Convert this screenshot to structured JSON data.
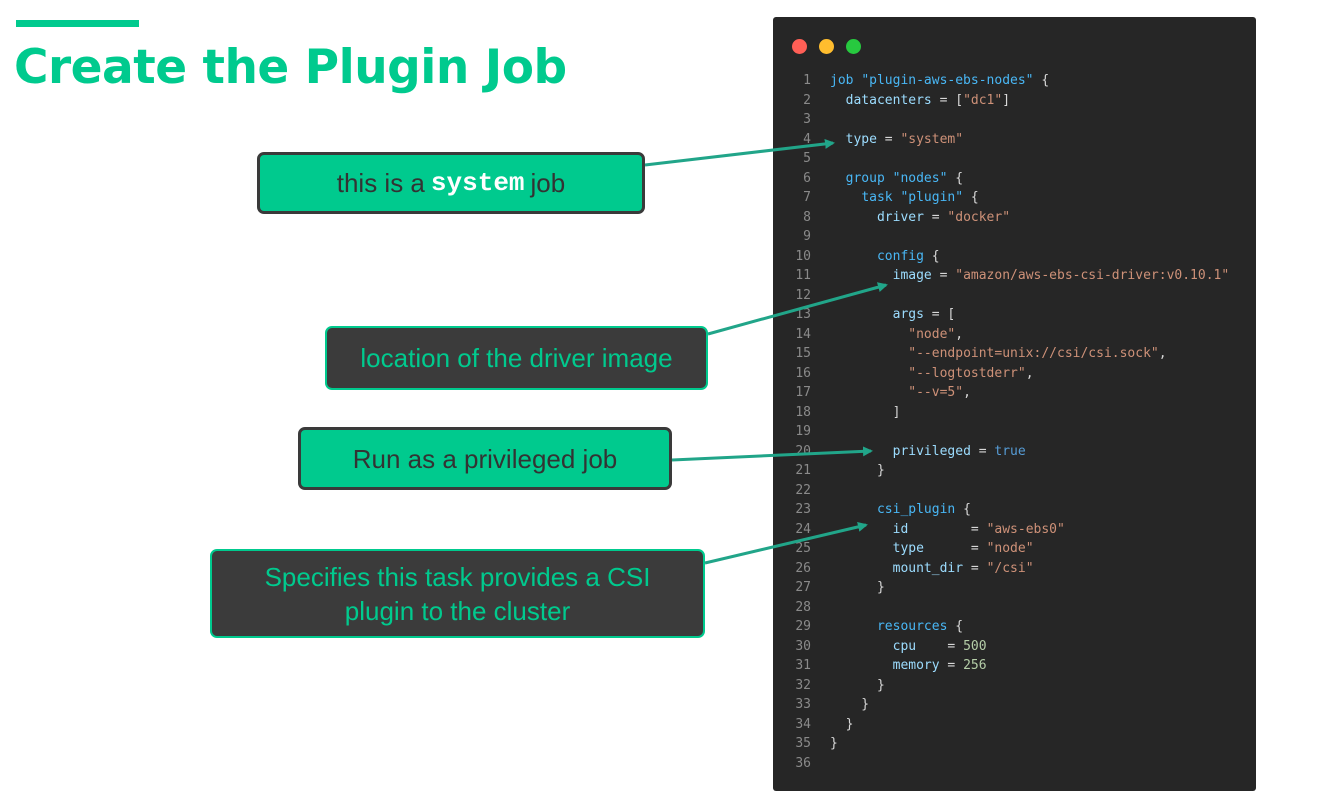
{
  "slide": {
    "title": "Create the Plugin Job"
  },
  "callouts": [
    {
      "pre": "this is a",
      "code": "system",
      "post": "job"
    },
    {
      "text": "location of the driver image"
    },
    {
      "text": "Run as a privileged job"
    },
    {
      "text": "Specifies this task provides a CSI plugin to the cluster"
    }
  ],
  "editor": {
    "lines": [
      {
        "n": "1",
        "tokens": [
          {
            "t": "job",
            "c": "#49b7f5"
          },
          {
            "t": " "
          },
          {
            "t": "\"plugin-aws-ebs-nodes\"",
            "c": "#49b7f5"
          },
          {
            "t": " {"
          }
        ]
      },
      {
        "n": "2",
        "tokens": [
          {
            "t": "  "
          },
          {
            "t": "datacenters",
            "c": "#9cdcfe"
          },
          {
            "t": " = ["
          },
          {
            "t": "\"dc1\"",
            "c": "#ce9178"
          },
          {
            "t": "]"
          }
        ]
      },
      {
        "n": "3",
        "tokens": []
      },
      {
        "n": "4",
        "tokens": [
          {
            "t": "  "
          },
          {
            "t": "type",
            "c": "#9cdcfe"
          },
          {
            "t": " = "
          },
          {
            "t": "\"system\"",
            "c": "#ce9178"
          }
        ]
      },
      {
        "n": "5",
        "tokens": []
      },
      {
        "n": "6",
        "tokens": [
          {
            "t": "  "
          },
          {
            "t": "group",
            "c": "#49b7f5"
          },
          {
            "t": " "
          },
          {
            "t": "\"nodes\"",
            "c": "#49b7f5"
          },
          {
            "t": " {"
          }
        ]
      },
      {
        "n": "7",
        "tokens": [
          {
            "t": "    "
          },
          {
            "t": "task",
            "c": "#49b7f5"
          },
          {
            "t": " "
          },
          {
            "t": "\"plugin\"",
            "c": "#49b7f5"
          },
          {
            "t": " {"
          }
        ]
      },
      {
        "n": "8",
        "tokens": [
          {
            "t": "      "
          },
          {
            "t": "driver",
            "c": "#9cdcfe"
          },
          {
            "t": " = "
          },
          {
            "t": "\"docker\"",
            "c": "#ce9178"
          }
        ]
      },
      {
        "n": "9",
        "tokens": []
      },
      {
        "n": "10",
        "tokens": [
          {
            "t": "      "
          },
          {
            "t": "config",
            "c": "#49b7f5"
          },
          {
            "t": " {"
          }
        ]
      },
      {
        "n": "11",
        "tokens": [
          {
            "t": "        "
          },
          {
            "t": "image",
            "c": "#9cdcfe"
          },
          {
            "t": " = "
          },
          {
            "t": "\"amazon/aws-ebs-csi-driver:v0.10.1\"",
            "c": "#ce9178"
          }
        ]
      },
      {
        "n": "12",
        "tokens": []
      },
      {
        "n": "13",
        "tokens": [
          {
            "t": "        "
          },
          {
            "t": "args",
            "c": "#9cdcfe"
          },
          {
            "t": " = ["
          }
        ]
      },
      {
        "n": "14",
        "tokens": [
          {
            "t": "          "
          },
          {
            "t": "\"node\"",
            "c": "#ce9178"
          },
          {
            "t": ","
          }
        ]
      },
      {
        "n": "15",
        "tokens": [
          {
            "t": "          "
          },
          {
            "t": "\"--endpoint=unix://csi/csi.sock\"",
            "c": "#ce9178"
          },
          {
            "t": ","
          }
        ]
      },
      {
        "n": "16",
        "tokens": [
          {
            "t": "          "
          },
          {
            "t": "\"--logtostderr\"",
            "c": "#ce9178"
          },
          {
            "t": ","
          }
        ]
      },
      {
        "n": "17",
        "tokens": [
          {
            "t": "          "
          },
          {
            "t": "\"--v=5\"",
            "c": "#ce9178"
          },
          {
            "t": ","
          }
        ]
      },
      {
        "n": "18",
        "tokens": [
          {
            "t": "        ]"
          }
        ]
      },
      {
        "n": "19",
        "tokens": []
      },
      {
        "n": "20",
        "tokens": [
          {
            "t": "        "
          },
          {
            "t": "privileged",
            "c": "#9cdcfe"
          },
          {
            "t": " = "
          },
          {
            "t": "true",
            "c": "#569cd6"
          }
        ]
      },
      {
        "n": "21",
        "tokens": [
          {
            "t": "      }"
          }
        ]
      },
      {
        "n": "22",
        "tokens": []
      },
      {
        "n": "23",
        "tokens": [
          {
            "t": "      "
          },
          {
            "t": "csi_plugin",
            "c": "#49b7f5"
          },
          {
            "t": " {"
          }
        ]
      },
      {
        "n": "24",
        "tokens": [
          {
            "t": "        "
          },
          {
            "t": "id",
            "c": "#9cdcfe"
          },
          {
            "t": "        = "
          },
          {
            "t": "\"aws-ebs0\"",
            "c": "#ce9178"
          }
        ]
      },
      {
        "n": "25",
        "tokens": [
          {
            "t": "        "
          },
          {
            "t": "type",
            "c": "#9cdcfe"
          },
          {
            "t": "      = "
          },
          {
            "t": "\"node\"",
            "c": "#ce9178"
          }
        ]
      },
      {
        "n": "26",
        "tokens": [
          {
            "t": "        "
          },
          {
            "t": "mount_dir",
            "c": "#9cdcfe"
          },
          {
            "t": " = "
          },
          {
            "t": "\"/csi\"",
            "c": "#ce9178"
          }
        ]
      },
      {
        "n": "27",
        "tokens": [
          {
            "t": "      }"
          }
        ]
      },
      {
        "n": "28",
        "tokens": []
      },
      {
        "n": "29",
        "tokens": [
          {
            "t": "      "
          },
          {
            "t": "resources",
            "c": "#49b7f5"
          },
          {
            "t": " {"
          }
        ]
      },
      {
        "n": "30",
        "tokens": [
          {
            "t": "        "
          },
          {
            "t": "cpu",
            "c": "#9cdcfe"
          },
          {
            "t": "    = "
          },
          {
            "t": "500",
            "c": "#b5cea8"
          }
        ]
      },
      {
        "n": "31",
        "tokens": [
          {
            "t": "        "
          },
          {
            "t": "memory",
            "c": "#9cdcfe"
          },
          {
            "t": " = "
          },
          {
            "t": "256",
            "c": "#b5cea8"
          }
        ]
      },
      {
        "n": "32",
        "tokens": [
          {
            "t": "      }"
          }
        ]
      },
      {
        "n": "33",
        "tokens": [
          {
            "t": "    }"
          }
        ]
      },
      {
        "n": "34",
        "tokens": [
          {
            "t": "  }"
          }
        ]
      },
      {
        "n": "35",
        "tokens": [
          {
            "t": "}"
          }
        ]
      },
      {
        "n": "36",
        "tokens": []
      }
    ]
  },
  "colors": {
    "accent": "#00ca8e",
    "editor_bg": "#262626",
    "callout_dark_bg": "#3b3b3b"
  }
}
